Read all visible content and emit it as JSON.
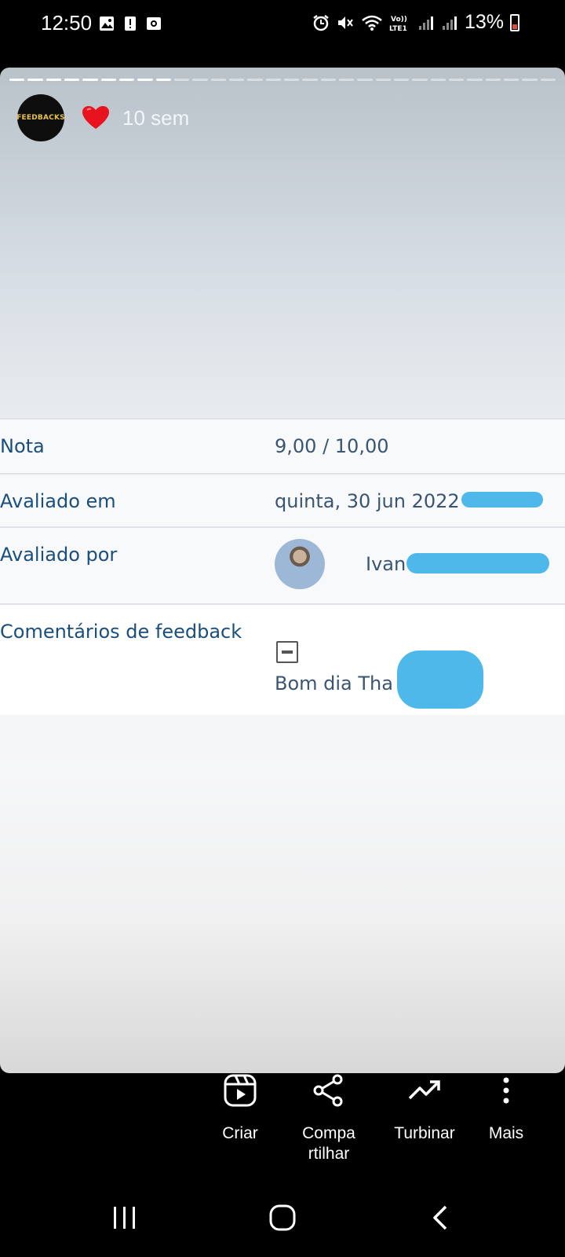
{
  "status_bar": {
    "time": "12:50",
    "battery": "13%",
    "network": "LTE1",
    "left_icons": [
      "image-icon",
      "alert-icon",
      "screen-record-icon"
    ],
    "right_icons": [
      "alarm-icon",
      "mute-icon",
      "wifi-icon",
      "volte-icon",
      "signal-icon",
      "signal-icon",
      "battery-icon"
    ]
  },
  "story": {
    "account_avatar_text": "FEEDBACKS",
    "reaction": "heart-icon",
    "time_ago": "10 sem",
    "progress": {
      "segments_total": 30,
      "segments_done": 9
    }
  },
  "grade": {
    "rows": [
      {
        "label": "Nota",
        "value": "9,00 / 10,00"
      },
      {
        "label": "Avaliado em",
        "value": "quinta, 30 jun 2022"
      },
      {
        "label": "Avaliado por",
        "value": "Ivan"
      },
      {
        "label": "Comentários de feedback",
        "value": "Bom dia Tha"
      }
    ]
  },
  "actions": [
    {
      "label": "Criar",
      "icon": "reels-icon"
    },
    {
      "label": "Compa\nrtilhar",
      "icon": "share-icon"
    },
    {
      "label": "Turbinar",
      "icon": "trending-up-icon"
    },
    {
      "label": "Mais",
      "icon": "more-vertical-icon"
    }
  ],
  "nav": [
    "recent-apps-icon",
    "home-icon",
    "back-icon"
  ],
  "colors": {
    "label_blue": "#1a4f7d",
    "value_blue": "#3a5571",
    "redaction_blue": "#4fb8ea",
    "battery_low": "#e84a3a"
  }
}
